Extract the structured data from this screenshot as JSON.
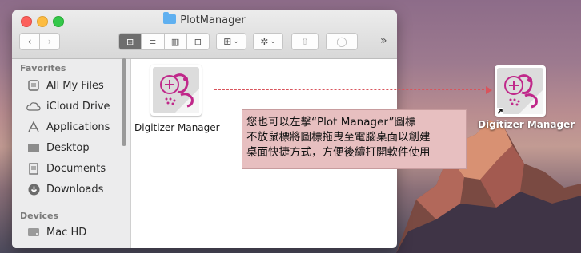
{
  "window": {
    "title": "PlotManager",
    "toolbar": {
      "back": "‹",
      "forward": "›",
      "view_icons": "⊞",
      "view_list": "≡",
      "view_columns": "▥",
      "view_gallery": "⊟",
      "group": "⊞",
      "group_caret": "⌄",
      "action": "✲",
      "action_caret": "⌄",
      "share": "⇧",
      "tags": "◯",
      "more": "»"
    }
  },
  "sidebar": {
    "favorites_header": "Favorites",
    "favorites": [
      {
        "label": "All My Files",
        "icon": "all-files-icon"
      },
      {
        "label": "iCloud Drive",
        "icon": "cloud-icon"
      },
      {
        "label": "Applications",
        "icon": "applications-icon"
      },
      {
        "label": "Desktop",
        "icon": "desktop-icon"
      },
      {
        "label": "Documents",
        "icon": "documents-icon"
      },
      {
        "label": "Downloads",
        "icon": "downloads-icon"
      }
    ],
    "devices_header": "Devices",
    "devices": [
      {
        "label": "Mac HD",
        "icon": "hard-drive-icon"
      }
    ]
  },
  "content": {
    "app_label": "Digitizer Manager"
  },
  "desktop": {
    "alias_label": "Digitizer Manager",
    "note_lines": [
      "您也可以左擊“Plot Manager”圖標",
      "不放鼠標將圖標拖曳至電腦桌面以創建",
      "桌面快捷方式，方便後續打開軟件使用"
    ]
  },
  "colors": {
    "note_background": "#e7bfc0",
    "drag_line": "#d9545c",
    "icon_magenta": "#c0288a"
  }
}
